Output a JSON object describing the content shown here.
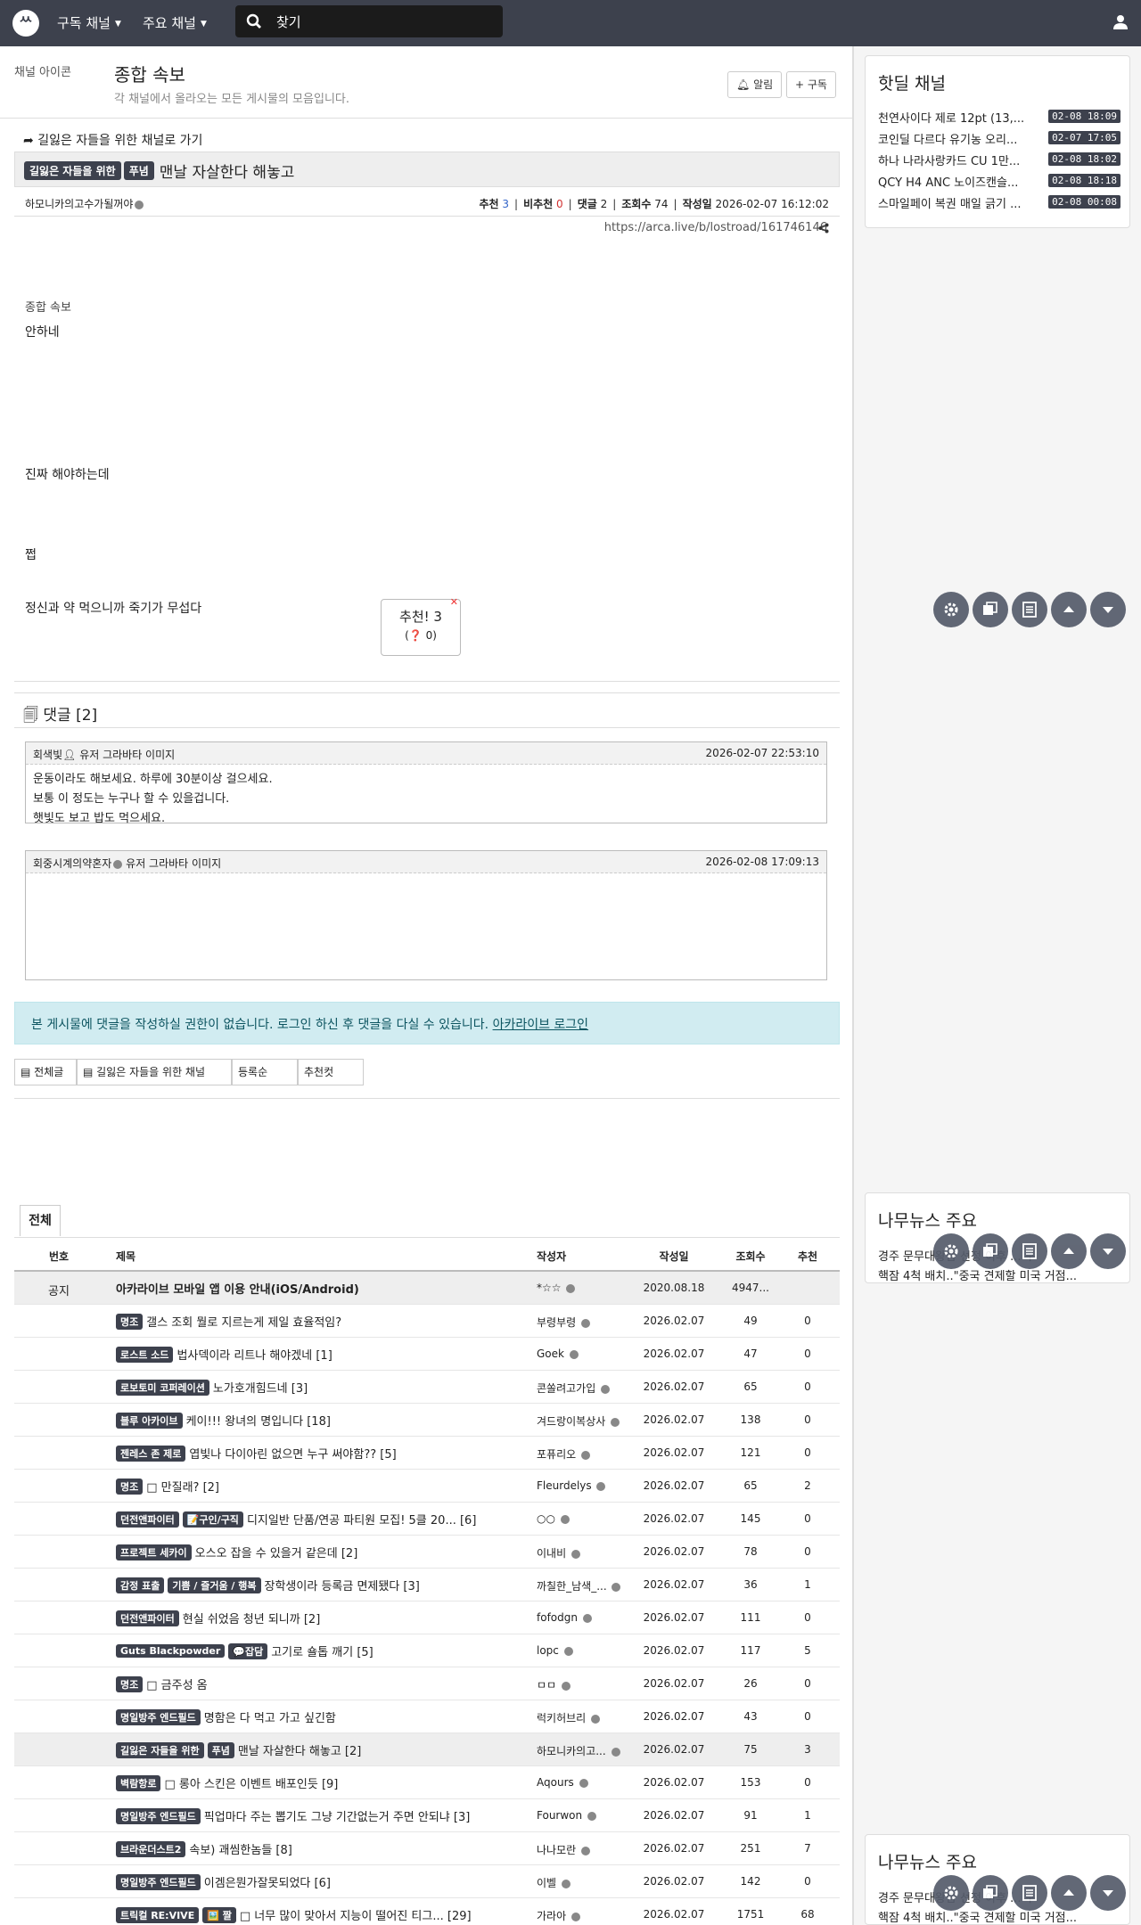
{
  "nav": {
    "logo": "ᄊ",
    "subscribed_channels": "구독 채널",
    "main_channels": "주요 채널",
    "search_placeholder": "찾기"
  },
  "board": {
    "icon_alt": "채널 아이콘",
    "title": "종합 속보",
    "description": "각 채널에서 올라오는 모든 게시물의 모음입니다.",
    "alarm_label": "알림",
    "subscribe_label": "구독"
  },
  "article": {
    "goto_label": "길잃은 자들을 위한 채널로 가기",
    "badge_channel": "길잃은 자들을 위한",
    "badge_category": "푸념",
    "title": "맨날 자살한다 해놓고",
    "author": "하모니카의고수가될꺼야",
    "stats": {
      "rec_label": "추천",
      "rec": "3",
      "nonrec_label": "비추천",
      "nonrec": "0",
      "comment_label": "댓글",
      "comments": "2",
      "view_label": "조회수",
      "views": "74",
      "date_label": "작성일",
      "date": "2026-02-07 16:12:02"
    },
    "url": "https://arca.live/b/lostroad/161746146",
    "image_alt": "종합 속보",
    "body": [
      "안하네",
      "진짜 해야하는데",
      "쩝",
      "정신과 약 먹으니까 죽기가 무섭다"
    ],
    "vote_label": "추천! 3",
    "vote_sub": "0"
  },
  "comments": {
    "title": "댓글 [2]",
    "items": [
      {
        "author": "회색빛",
        "avatar_alt": "유저 그라바타 이미지",
        "date": "2026-02-07 22:53:10",
        "lines": [
          "운동이라도 해보세요. 하루에 30분이상 걸으세요.",
          "보통 이 정도는 누구나 할 수 있을겁니다.",
          "햇빛도 보고 밥도 먹으세요."
        ]
      },
      {
        "author": "회중시계의약혼자",
        "avatar_alt": "유저 그라바타 이미지",
        "date": "2026-02-08 17:09:13",
        "lines": []
      }
    ],
    "login_notice": "본 게시물에 댓글을 작성하실 권한이 없습니다. 로그인 하신 후 댓글을 다실 수 있습니다.",
    "login_link": "아카라이브 로그인"
  },
  "list_tabs": [
    "전체글",
    "길잃은 자들을 위한 채널",
    "등록순",
    "추천컷"
  ],
  "table": {
    "tab": "전체",
    "headers": {
      "no": "번호",
      "title": "제목",
      "author": "작성자",
      "date": "작성일",
      "views": "조회수",
      "rec": "추천"
    },
    "rows": [
      {
        "no": "공지",
        "badges": [],
        "title": "아카라이브 모바일 앱 이용 안내(iOS/Android)",
        "author": "*☆☆",
        "date": "2020.08.18",
        "views": "4947...",
        "rec": "",
        "notice": true
      },
      {
        "no": "",
        "badges": [
          "명조"
        ],
        "title": "갤스 조회 뭘로 지르는게 제일 효율적임?",
        "author": "부령부령",
        "date": "2026.02.07",
        "views": "49",
        "rec": "0"
      },
      {
        "no": "",
        "badges": [
          "로스트 소드"
        ],
        "title": "법사덱이라 리트나 해야겠네 [1]",
        "author": "Goek",
        "date": "2026.02.07",
        "views": "47",
        "rec": "0"
      },
      {
        "no": "",
        "badges": [
          "로보토미 코퍼레이션"
        ],
        "title": "노가호개힘드네 [3]",
        "author": "콘쏠려고가입",
        "date": "2026.02.07",
        "views": "65",
        "rec": "0"
      },
      {
        "no": "",
        "badges": [
          "블루 아카이브"
        ],
        "title": "케이!!! 왕녀의 명입니다 [18]",
        "author": "겨드랑이복상사",
        "date": "2026.02.07",
        "views": "138",
        "rec": "0"
      },
      {
        "no": "",
        "badges": [
          "젠레스 존 제로"
        ],
        "title": "엽빛나 다이아린 없으면 누구 써야함?? [5]",
        "author": "포퓨리오",
        "date": "2026.02.07",
        "views": "121",
        "rec": "0"
      },
      {
        "no": "",
        "badges": [
          "명조"
        ],
        "title": "□ 만질래? [2]",
        "author": "Fleurdelys",
        "date": "2026.02.07",
        "views": "65",
        "rec": "2"
      },
      {
        "no": "",
        "badges": [
          "던전앤파이터",
          "📝구인/구직"
        ],
        "title": "디지일반 단품/연공 파티원 모집! 5클 20... [6]",
        "author": "○○",
        "date": "2026.02.07",
        "views": "145",
        "rec": "0"
      },
      {
        "no": "",
        "badges": [
          "프로젝트 세카이"
        ],
        "title": "오스오 잡을 수 있을거 같은데 [2]",
        "author": "이내비",
        "date": "2026.02.07",
        "views": "78",
        "rec": "0"
      },
      {
        "no": "",
        "badges": [
          "감정 표출",
          "기쁨 / 즐거움 / 행복"
        ],
        "title": "장학생이라 등록금 면제됐다 [3]",
        "author": "까칠한_남색_...",
        "date": "2026.02.07",
        "views": "36",
        "rec": "1"
      },
      {
        "no": "",
        "badges": [
          "던전앤파이터"
        ],
        "title": "현실 쉬었음 청년 되니까 [2]",
        "author": "fofodgn",
        "date": "2026.02.07",
        "views": "111",
        "rec": "0"
      },
      {
        "no": "",
        "badges": [
          "Guts Blackpowder",
          "💬잡담"
        ],
        "title": "고기로 숄톱 깨기 [5]",
        "author": "lopc",
        "date": "2026.02.07",
        "views": "117",
        "rec": "5"
      },
      {
        "no": "",
        "badges": [
          "명조"
        ],
        "title": "□ 금주성 옴",
        "author": "ㅁㅁ",
        "date": "2026.02.07",
        "views": "26",
        "rec": "0"
      },
      {
        "no": "",
        "badges": [
          "명일방주 엔드필드"
        ],
        "title": "명함은 다 먹고 가고 싶긴함",
        "author": "럭키허브리",
        "date": "2026.02.07",
        "views": "43",
        "rec": "0"
      },
      {
        "no": "",
        "badges": [
          "길잃은 자들을 위한",
          "푸념"
        ],
        "title": "맨날 자살한다 해놓고 [2]",
        "author": "하모니카의고...",
        "date": "2026.02.07",
        "views": "75",
        "rec": "3",
        "highlight": true
      },
      {
        "no": "",
        "badges": [
          "벽람항로"
        ],
        "title": "□ 롱아 스킨은 이벤트 배포인듯 [9]",
        "author": "Aqours",
        "date": "2026.02.07",
        "views": "153",
        "rec": "0"
      },
      {
        "no": "",
        "badges": [
          "명일방주 엔드필드"
        ],
        "title": "픽업마다 주는 뽑기도 그냥 기간없는거 주면 안되냐 [3]",
        "author": "Fourwon",
        "date": "2026.02.07",
        "views": "91",
        "rec": "1"
      },
      {
        "no": "",
        "badges": [
          "브라운더스트2"
        ],
        "title": "속보) 괘씸한놈들 [8]",
        "author": "나나모란",
        "date": "2026.02.07",
        "views": "251",
        "rec": "7"
      },
      {
        "no": "",
        "badges": [
          "명일방주 엔드필드"
        ],
        "title": "이겜은뭔가잘못되었다 [6]",
        "author": "이벨",
        "date": "2026.02.07",
        "views": "142",
        "rec": "0"
      },
      {
        "no": "",
        "badges": [
          "트릭컬 RE:VIVE",
          "🖼️ 짤"
        ],
        "title": "□ 너무 많이 맞아서 지능이 떨어진 티그...  [29]",
        "author": "가라아",
        "date": "2026.02.07",
        "views": "1751",
        "rec": "68"
      }
    ]
  },
  "sidebar": {
    "hotdeal_title": "핫딜 채널",
    "hotdeals": [
      {
        "title": "천연사이다 제로 12pt (13,...",
        "date": "02-08 18:09"
      },
      {
        "title": "코인딜 다르다 유기농 오리...",
        "date": "02-07 17:05"
      },
      {
        "title": "하나 나라사랑카드 CU 1만...",
        "date": "02-08 18:02"
      },
      {
        "title": "QCY H4 ANC 노이즈캔슬...",
        "date": "02-08 18:18"
      },
      {
        "title": "스마일페이 복권 매일 긁기 ...",
        "date": "02-08 00:08"
      }
    ],
    "news_title": "나무뉴스 주요",
    "news": [
      "경주 문무대왕함 선정 이후 ... 구",
      "핵잠 4척 배치..\"중국 견제할 미국 거점..."
    ]
  }
}
